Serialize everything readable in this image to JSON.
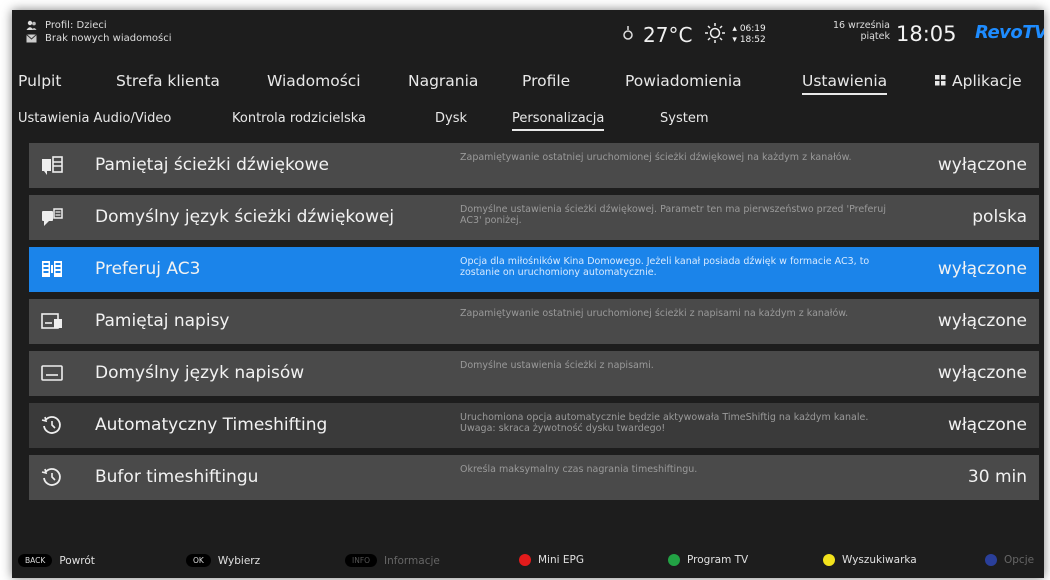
{
  "profile": {
    "name": "Profil: Dzieci",
    "messages": "Brak nowych wiadomości"
  },
  "weather": {
    "temperature": "27°C",
    "sunrise": "06:19",
    "sunset": "18:52"
  },
  "date": {
    "day": "16 września",
    "weekday": "piątek"
  },
  "clock": "18:05",
  "brand": "RevoTV",
  "main_nav": [
    "Pulpit",
    "Strefa klienta",
    "Wiadomości",
    "Nagrania",
    "Profile",
    "Powiadomienia",
    "Ustawienia",
    "Aplikacje"
  ],
  "main_nav_active": "Ustawienia",
  "sub_nav": [
    "Ustawienia Audio/Video",
    "Kontrola rodzicielska",
    "Dysk",
    "Personalizacja",
    "System"
  ],
  "sub_nav_active": "Personalizacja",
  "settings": [
    {
      "icon": "audio-track-icon",
      "label": "Pamiętaj ścieżki dźwiękowe",
      "description": "Zapamiętywanie ostatniej uruchomionej ścieżki dźwiękowej na każdym z kanałów.",
      "value": "wyłączone"
    },
    {
      "icon": "audio-language-icon",
      "label": "Domyślny język ścieżki dźwiękowej",
      "description": "Domyślne ustawienia ścieżki dźwiękowej. Parametr ten ma pierwszeństwo przed 'Preferuj AC3' poniżej.",
      "value": "polska"
    },
    {
      "icon": "ac3-icon",
      "label": "Preferuj AC3",
      "description": "Opcja dla miłośników Kina Domowego. Jeżeli kanał posiada dźwięk w formacie AC3, to zostanie on uruchomiony automatycznie.",
      "value": "wyłączone"
    },
    {
      "icon": "subtitles-remember-icon",
      "label": "Pamiętaj napisy",
      "description": "Zapamiętywanie ostatniej uruchomionej ścieżki z napisami na każdym z kanałów.",
      "value": "wyłączone"
    },
    {
      "icon": "subtitles-language-icon",
      "label": "Domyślny język napisów",
      "description": "Domyślne ustawienia ścieżki z napisami.",
      "value": "wyłączone"
    },
    {
      "icon": "timeshift-icon",
      "label": "Automatyczny Timeshifting",
      "description": "Uruchomiona opcja automatycznie będzie aktywowała TimeShiftig na każdym kanale. Uwaga: skraca żywotność dysku twardego!",
      "value": "włączone"
    },
    {
      "icon": "timeshift-buffer-icon",
      "label": "Bufor timeshiftingu",
      "description": "Określa maksymalny czas nagrania timeshiftingu.",
      "value": "30 min"
    }
  ],
  "selected_setting": "Preferuj AC3",
  "bottom_hints": {
    "back": {
      "key": "BACK",
      "label": "Powrót"
    },
    "ok": {
      "key": "OK",
      "label": "Wybierz"
    },
    "info": {
      "key": "INFO",
      "label": "Informacje"
    },
    "red": {
      "label": "Mini EPG",
      "color": "#e21b1b"
    },
    "green": {
      "label": "Program TV",
      "color": "#22a244"
    },
    "yellow": {
      "label": "Wyszukiwarka",
      "color": "#f2e21c"
    },
    "blue": {
      "label": "Opcje",
      "color": "#2a3f9a"
    }
  },
  "colors": {
    "accent": "#1b84ea",
    "row": "#4a4a4a",
    "row_alt": "#3a3a3a",
    "background": "#1d1d1d"
  }
}
